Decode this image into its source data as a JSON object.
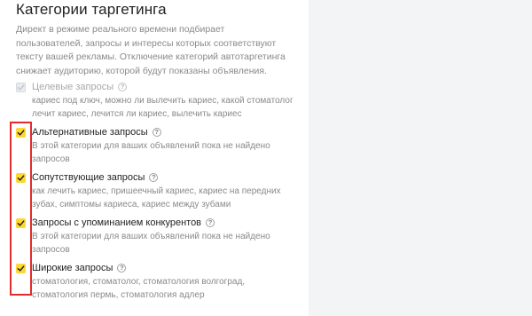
{
  "header": {
    "title": "Категории таргетинга"
  },
  "description": "Директ в режиме реального времени подбирает пользователей, запросы и интересы которых соответствуют тексту вашей рекламы. Отключение категорий автотаргетинга снижает аудиторию, которой будут показаны объявления.",
  "categories": [
    {
      "label": "Целевые запросы",
      "description": "кариес под ключ, можно ли вылечить кариес, какой стоматолог лечит кариес, лечится ли кариес, вылечить кариес",
      "checked": true,
      "disabled": true
    },
    {
      "label": "Альтернативные запросы",
      "description": "В этой категории для ваших объявлений пока не найдено запросов",
      "checked": true,
      "disabled": false
    },
    {
      "label": "Сопутствующие запросы",
      "description": "как лечить кариес, пришеечный кариес, кариес на передних зубах, симптомы кариеса, кариес между зубами",
      "checked": true,
      "disabled": false
    },
    {
      "label": "Запросы с упоминанием конкурентов",
      "description": "В этой категории для ваших объявлений пока не найдено запросов",
      "checked": true,
      "disabled": false
    },
    {
      "label": "Широкие запросы",
      "description": "стоматология, стоматолог, стоматология волгоград, стоматология пермь, стоматология адлер",
      "checked": true,
      "disabled": false
    }
  ],
  "icons": {
    "checkbox_check": "checkmark-icon",
    "help": "question-icon",
    "help_glyph": "?"
  },
  "colors": {
    "checkbox_on": "#fdd834",
    "highlight": "#e32b2b",
    "side_panel": "#f3f4f6"
  }
}
